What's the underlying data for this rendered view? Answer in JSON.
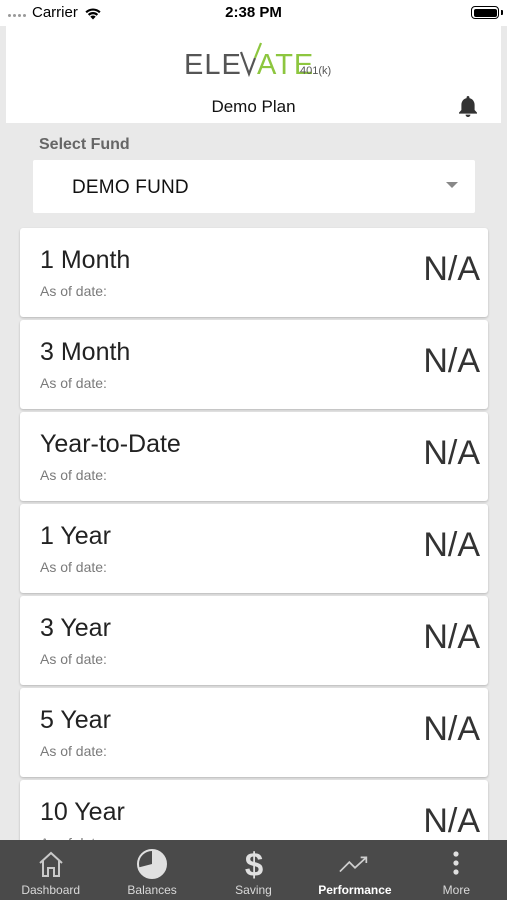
{
  "status_bar": {
    "carrier": "Carrier",
    "time": "2:38 PM"
  },
  "header": {
    "logo_text": "ELEVATE",
    "logo_suffix": "401(k)",
    "plan_name": "Demo Plan",
    "notification_icon": "bell-icon"
  },
  "fund_selector": {
    "label": "Select Fund",
    "selected": "DEMO FUND"
  },
  "periods": [
    {
      "title": "1 Month",
      "as_of": "As of date:",
      "value": "N/A"
    },
    {
      "title": "3 Month",
      "as_of": "As of date:",
      "value": "N/A"
    },
    {
      "title": "Year-to-Date",
      "as_of": "As of date:",
      "value": "N/A"
    },
    {
      "title": "1 Year",
      "as_of": "As of date:",
      "value": "N/A"
    },
    {
      "title": "3 Year",
      "as_of": "As of date:",
      "value": "N/A"
    },
    {
      "title": "5 Year",
      "as_of": "As of date:",
      "value": "N/A"
    },
    {
      "title": "10 Year",
      "as_of": "As of date:",
      "value": "N/A"
    }
  ],
  "tabs": [
    {
      "label": "Dashboard",
      "icon": "home-icon",
      "active": false
    },
    {
      "label": "Balances",
      "icon": "pie-chart-icon",
      "active": false
    },
    {
      "label": "Saving",
      "icon": "dollar-icon",
      "active": false
    },
    {
      "label": "Performance",
      "icon": "trending-up-icon",
      "active": true
    },
    {
      "label": "More",
      "icon": "more-vertical-icon",
      "active": false
    }
  ],
  "colors": {
    "brand_green": "#8dc63f",
    "logo_gray": "#555555",
    "tab_bar_bg": "#4a4a4a",
    "page_bg": "#e9e9e9"
  }
}
